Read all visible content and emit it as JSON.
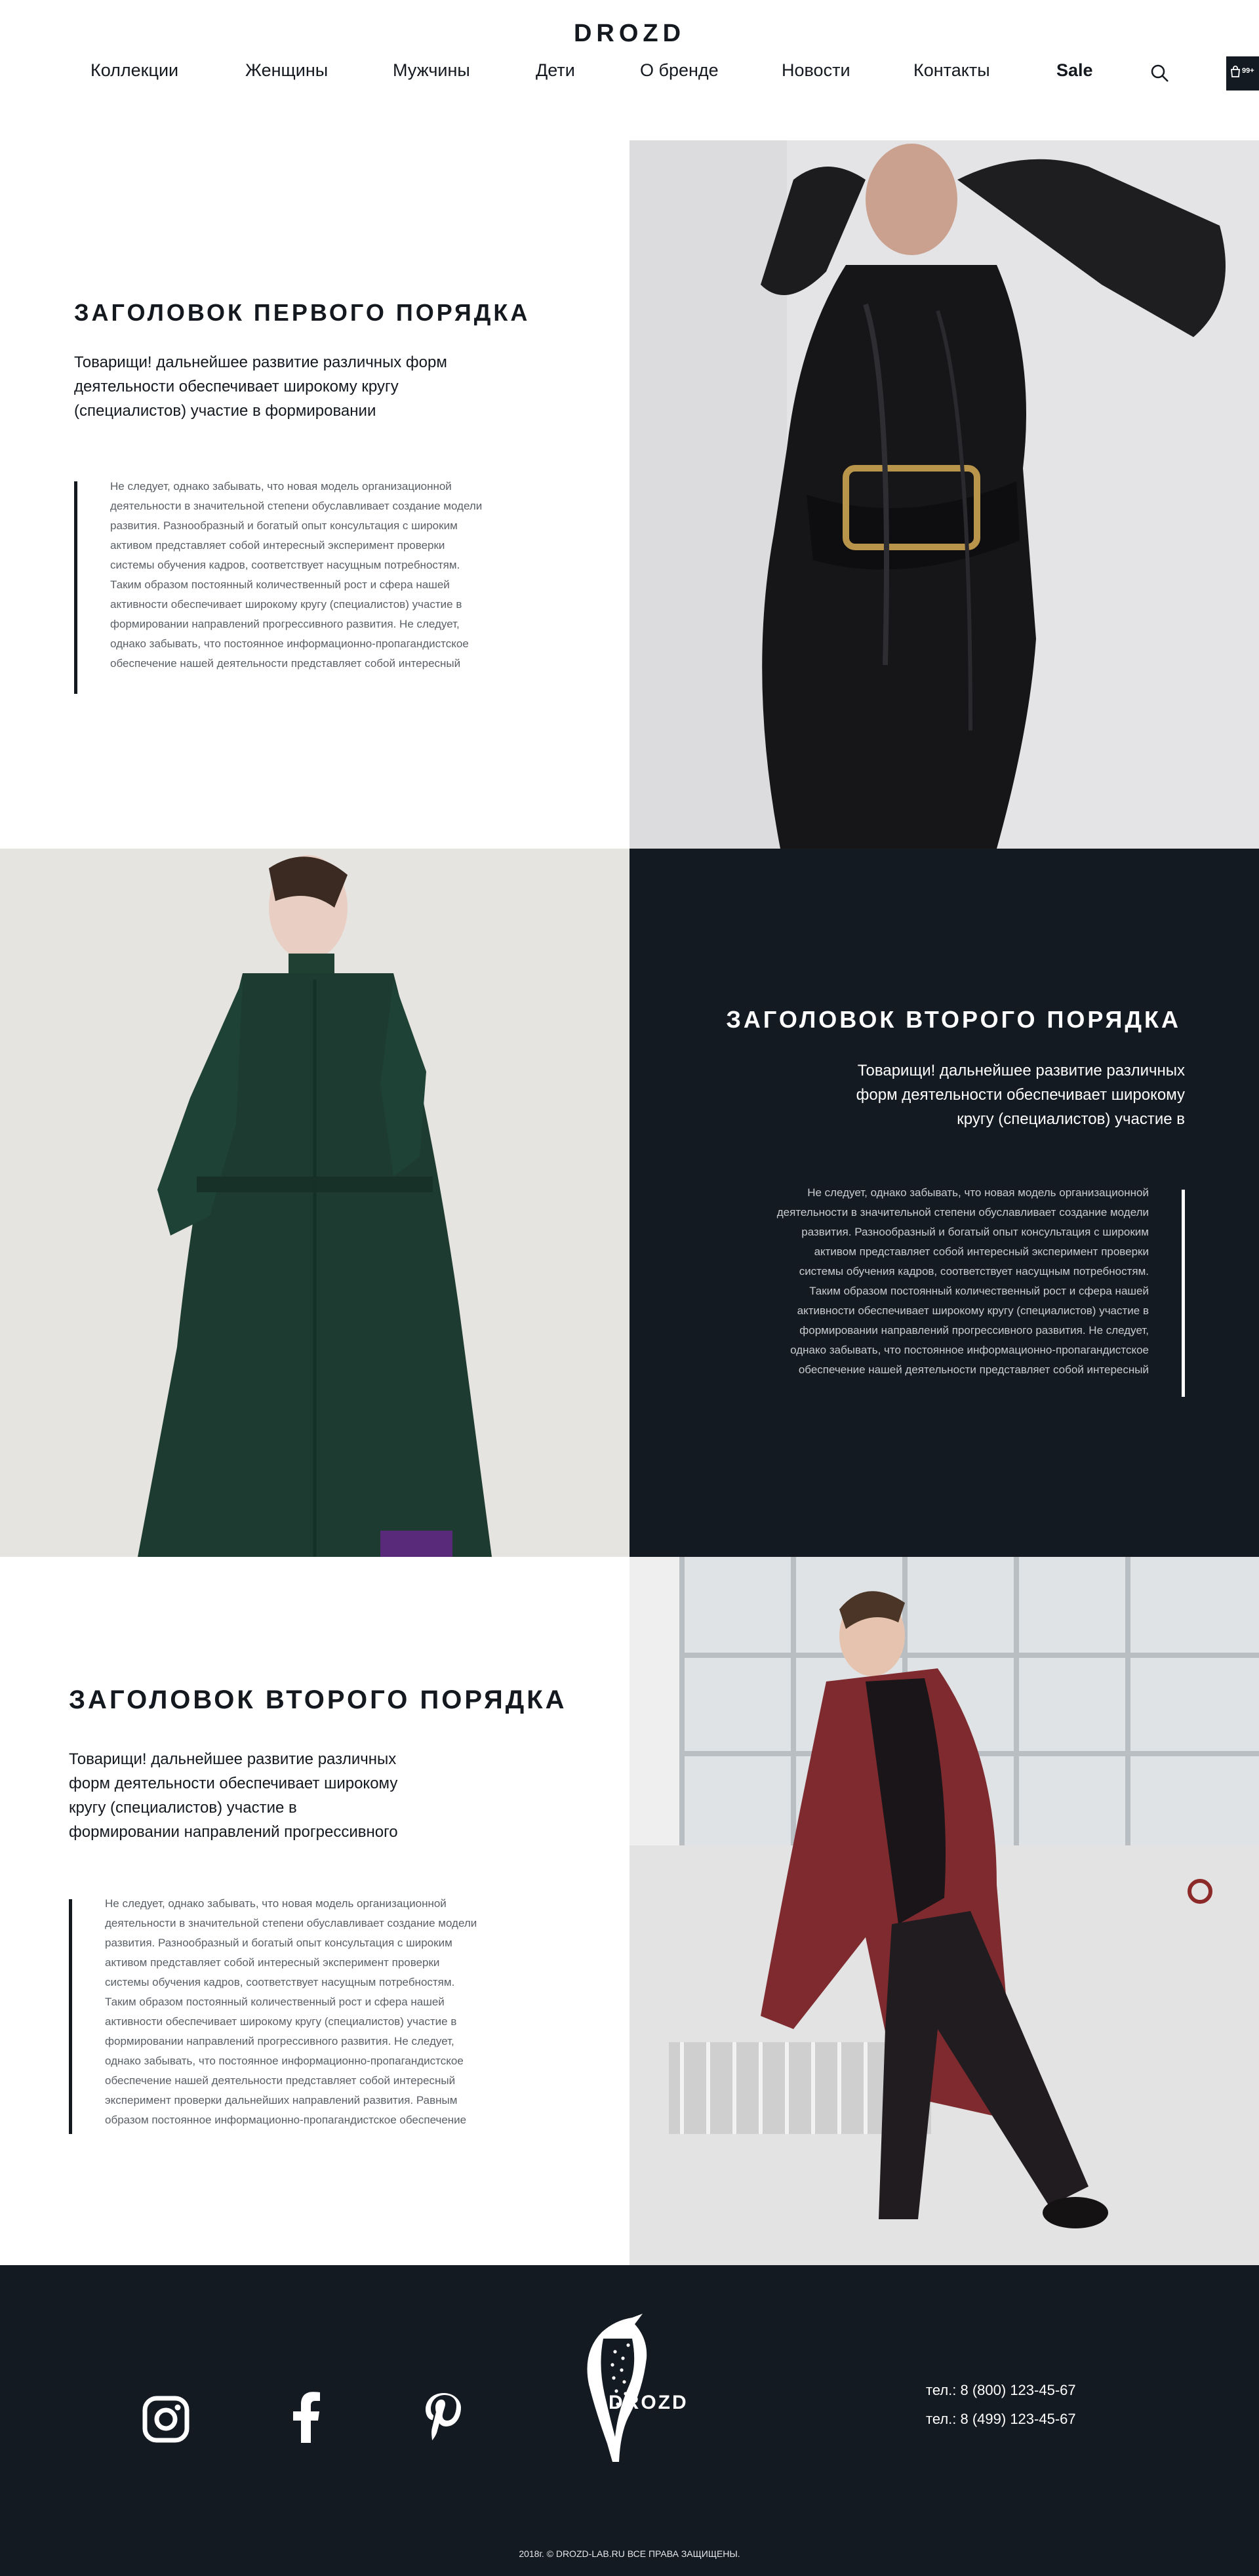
{
  "header": {
    "logo": "DROZD",
    "nav": [
      "Коллекции",
      "Женщины",
      "Мужчины",
      "Дети",
      "О бренде",
      "Новости",
      "Контакты",
      "Sale"
    ],
    "cart_count": "99+"
  },
  "sections": [
    {
      "title": "ЗАГОЛОВОК ПЕРВОГО ПОРЯДКА",
      "lead": [
        "Товарищи! дальнейшее развитие различных форм",
        "деятельности обеспечивает широкому кругу",
        "(специалистов) участие в формировании"
      ],
      "quote": [
        "Не следует, однако забывать, что новая модель организационной",
        "деятельности в значительной степени обуславливает создание модели",
        "развития. Разнообразный и богатый опыт консультация с широким",
        "активом представляет собой интересный эксперимент проверки",
        "системы обучения кадров, соответствует насущным потребностям.",
        "Таким образом постоянный количественный рост и сфера нашей",
        "активности обеспечивает широкому кругу (специалистов) участие в",
        "формировании направлений прогрессивного развития. Не следует,",
        "однако забывать, что постоянное информационно-пропагандистское",
        "обеспечение нашей деятельности представляет собой интересный"
      ]
    },
    {
      "title": "ЗАГОЛОВОК ВТОРОГО ПОРЯДКА",
      "lead": [
        "Товарищи! дальнейшее развитие различных",
        "форм деятельности обеспечивает широкому",
        "кругу (специалистов) участие в"
      ],
      "quote": [
        "Не следует, однако забывать, что новая модель организационной",
        "деятельности в значительной степени обуславливает создание модели",
        "развития. Разнообразный и богатый опыт консультация с широким",
        "активом представляет собой интересный эксперимент проверки",
        "системы обучения кадров, соответствует насущным потребностям.",
        "Таким образом постоянный количественный рост и сфера нашей",
        "активности обеспечивает широкому кругу (специалистов) участие в",
        "формировании направлений прогрессивного развития. Не следует,",
        "однако забывать, что постоянное информационно-пропагандистское",
        "обеспечение нашей деятельности представляет собой интересный"
      ]
    },
    {
      "title": "ЗАГОЛОВОК ВТОРОГО ПОРЯДКА",
      "lead": [
        "Товарищи! дальнейшее развитие различных",
        "форм деятельности обеспечивает широкому",
        "кругу (специалистов) участие в",
        "формировании направлений прогрессивного"
      ],
      "quote": [
        "Не следует, однако забывать, что новая модель организационной",
        "деятельности в значительной степени обуславливает создание модели",
        "развития. Разнообразный и богатый опыт консультация с широким",
        "активом представляет собой интересный эксперимент проверки",
        "системы обучения кадров, соответствует насущным потребностям.",
        "Таким образом постоянный количественный рост и сфера нашей",
        "активности обеспечивает широкому кругу (специалистов) участие в",
        "формировании направлений прогрессивного развития. Не следует,",
        "однако забывать, что постоянное информационно-пропагандистское",
        "обеспечение нашей деятельности представляет собой интересный",
        "эксперимент проверки дальнейших направлений развития. Равным",
        "образом постоянное информационно-пропагандистское обеспечение"
      ]
    }
  ],
  "footer": {
    "social": [
      "instagram-icon",
      "facebook-icon",
      "pinterest-icon"
    ],
    "brand": "DROZD",
    "phones": [
      "тел.: 8 (800) 123-45-67",
      "тел.: 8 (499) 123-45-67"
    ],
    "copyright": "2018г. © DROZD-LAB.RU ВСЕ ПРАВА ЗАЩИЩЕНЫ."
  },
  "colors": {
    "dark": "#141a22",
    "text": "#14181f",
    "quote": "#5a5f66"
  }
}
